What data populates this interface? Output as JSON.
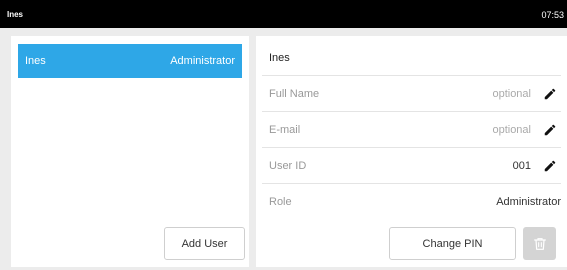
{
  "status_bar": {
    "title": "Ines",
    "time": "07:53"
  },
  "users": [
    {
      "name": "Ines",
      "role": "Administrator"
    }
  ],
  "left_panel": {
    "add_user_label": "Add User"
  },
  "details": {
    "name": "Ines",
    "fields": [
      {
        "label": "Full Name",
        "value": "optional",
        "editable": true
      },
      {
        "label": "E-mail",
        "value": "optional",
        "editable": true
      },
      {
        "label": "User ID",
        "value": "001",
        "editable": true
      },
      {
        "label": "Role",
        "value": "Administrator",
        "editable": false
      }
    ],
    "change_pin_label": "Change PIN"
  },
  "colors": {
    "accent": "#2ea7e7",
    "statusbar": "#000000",
    "delete_button": "#d4d4d4"
  }
}
